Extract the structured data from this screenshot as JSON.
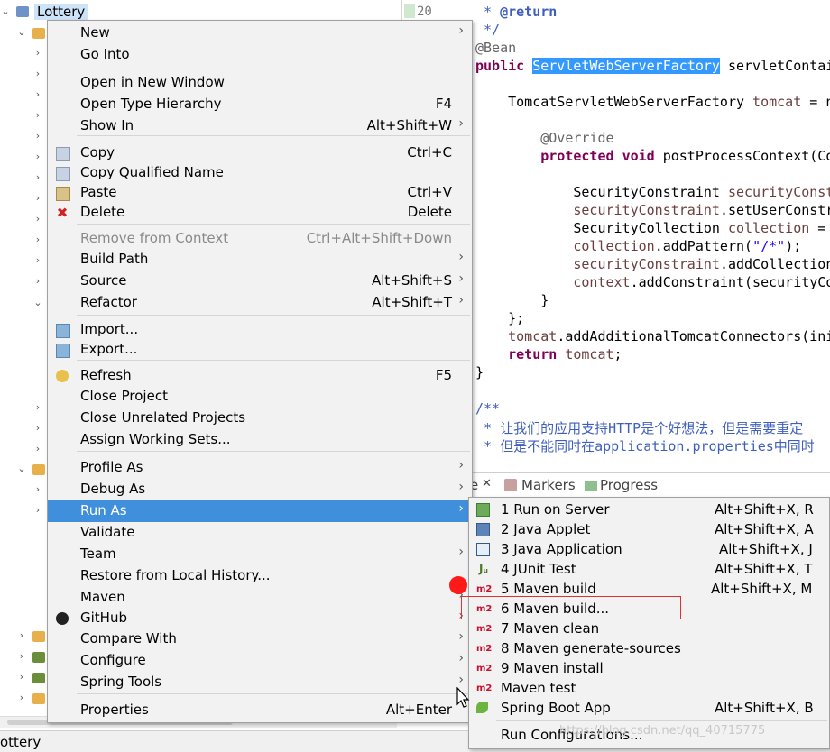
{
  "explorer": {
    "project_name": "Lottery",
    "icons": [
      "java-project-icon",
      "package-folder-icon",
      "jar-icon"
    ]
  },
  "editor": {
    "line_number": "20",
    "lines": [
      " * @return",
      " */",
      "@Bean",
      "public ServletWebServerFactory servletContai",
      "",
      "    TomcatServletWebServerFactory tomcat = n",
      "",
      "        @Override",
      "        protected void postProcessContext(Co",
      "",
      "            SecurityConstraint securityConst",
      "            securityConstraint.setUserConstr",
      "            SecurityCollection collection =",
      "            collection.addPattern(\"/*\");",
      "            securityConstraint.addCollection",
      "            context.addConstraint(securityCo",
      "        }",
      "    };",
      "    tomcat.addAdditionalTomcatConnectors(ini",
      "    return tomcat;",
      "}",
      "",
      "/**",
      " * 让我们的应用支持HTTP是个好想法，但是需要重定",
      " * 但是不能同时在application.properties中同时"
    ]
  },
  "views": {
    "tabs": [
      "Markers",
      "Progress"
    ],
    "close_glyph": "✕",
    "truncated_tab_suffix": "e"
  },
  "status_bar": {
    "text": "ottery"
  },
  "context_menu": {
    "items": [
      {
        "label": "New",
        "shortcut": "",
        "submenu": true
      },
      {
        "label": "Go Into",
        "shortcut": ""
      },
      {
        "label": "Open in New Window",
        "shortcut": ""
      },
      {
        "label": "Open Type Hierarchy",
        "shortcut": "F4"
      },
      {
        "label": "Show In",
        "shortcut": "Alt+Shift+W",
        "submenu": true
      },
      {
        "label": "Copy",
        "shortcut": "Ctrl+C",
        "icon": "copy-icon"
      },
      {
        "label": "Copy Qualified Name",
        "shortcut": "",
        "icon": "copy-qualified-icon"
      },
      {
        "label": "Paste",
        "shortcut": "Ctrl+V",
        "icon": "paste-icon"
      },
      {
        "label": "Delete",
        "shortcut": "Delete",
        "icon": "delete-icon"
      },
      {
        "label": "Remove from Context",
        "shortcut": "Ctrl+Alt+Shift+Down",
        "disabled": true
      },
      {
        "label": "Build Path",
        "shortcut": "",
        "submenu": true
      },
      {
        "label": "Source",
        "shortcut": "Alt+Shift+S",
        "submenu": true
      },
      {
        "label": "Refactor",
        "shortcut": "Alt+Shift+T",
        "submenu": true
      },
      {
        "label": "Import...",
        "shortcut": "",
        "icon": "import-icon"
      },
      {
        "label": "Export...",
        "shortcut": "",
        "icon": "export-icon"
      },
      {
        "label": "Refresh",
        "shortcut": "F5",
        "icon": "refresh-icon"
      },
      {
        "label": "Close Project",
        "shortcut": ""
      },
      {
        "label": "Close Unrelated Projects",
        "shortcut": ""
      },
      {
        "label": "Assign Working Sets...",
        "shortcut": ""
      },
      {
        "label": "Profile As",
        "shortcut": "",
        "submenu": true
      },
      {
        "label": "Debug As",
        "shortcut": "",
        "submenu": true
      },
      {
        "label": "Run As",
        "shortcut": "",
        "submenu": true,
        "selected": true
      },
      {
        "label": "Validate",
        "shortcut": ""
      },
      {
        "label": "Team",
        "shortcut": "",
        "submenu": true
      },
      {
        "label": "Restore from Local History...",
        "shortcut": ""
      },
      {
        "label": "Maven",
        "shortcut": "",
        "submenu": true
      },
      {
        "label": "GitHub",
        "shortcut": "",
        "submenu": true,
        "icon": "github-icon"
      },
      {
        "label": "Compare With",
        "shortcut": "",
        "submenu": true
      },
      {
        "label": "Configure",
        "shortcut": "",
        "submenu": true
      },
      {
        "label": "Spring Tools",
        "shortcut": "",
        "submenu": true
      },
      {
        "label": "Properties",
        "shortcut": "Alt+Enter"
      }
    ]
  },
  "run_as_menu": {
    "items": [
      {
        "label": "1 Run on Server",
        "shortcut": "Alt+Shift+X, R",
        "icon": "server-icon"
      },
      {
        "label": "2 Java Applet",
        "shortcut": "Alt+Shift+X, A",
        "icon": "applet-icon"
      },
      {
        "label": "3 Java Application",
        "shortcut": "Alt+Shift+X, J",
        "icon": "java-app-icon"
      },
      {
        "label": "4 JUnit Test",
        "shortcut": "Alt+Shift+X, T",
        "icon": "junit-icon",
        "icon_text": "Jᵤ"
      },
      {
        "label": "5 Maven build",
        "shortcut": "Alt+Shift+X, M",
        "icon": "maven-icon",
        "icon_text": "m2"
      },
      {
        "label": "6 Maven build...",
        "shortcut": "",
        "icon": "maven-icon",
        "icon_text": "m2",
        "highlighted": true
      },
      {
        "label": "7 Maven clean",
        "shortcut": "",
        "icon": "maven-icon",
        "icon_text": "m2"
      },
      {
        "label": "8 Maven generate-sources",
        "shortcut": "",
        "icon": "maven-icon",
        "icon_text": "m2"
      },
      {
        "label": "9 Maven install",
        "shortcut": "",
        "icon": "maven-icon",
        "icon_text": "m2"
      },
      {
        "label": "Maven test",
        "shortcut": "",
        "icon": "maven-icon",
        "icon_text": "m2"
      },
      {
        "label": "Spring Boot App",
        "shortcut": "Alt+Shift+X, B",
        "icon": "spring-boot-icon"
      },
      {
        "label": "Run Configurations...",
        "shortcut": ""
      }
    ]
  },
  "submenu_arrow": "›",
  "watermark": "https://blog.csdn.net/qq_40715775",
  "colors": {
    "selection": "#3f8fdc",
    "highlight_box": "#e03030",
    "keyword": "#7f0055",
    "comment": "#3f5fbf"
  }
}
